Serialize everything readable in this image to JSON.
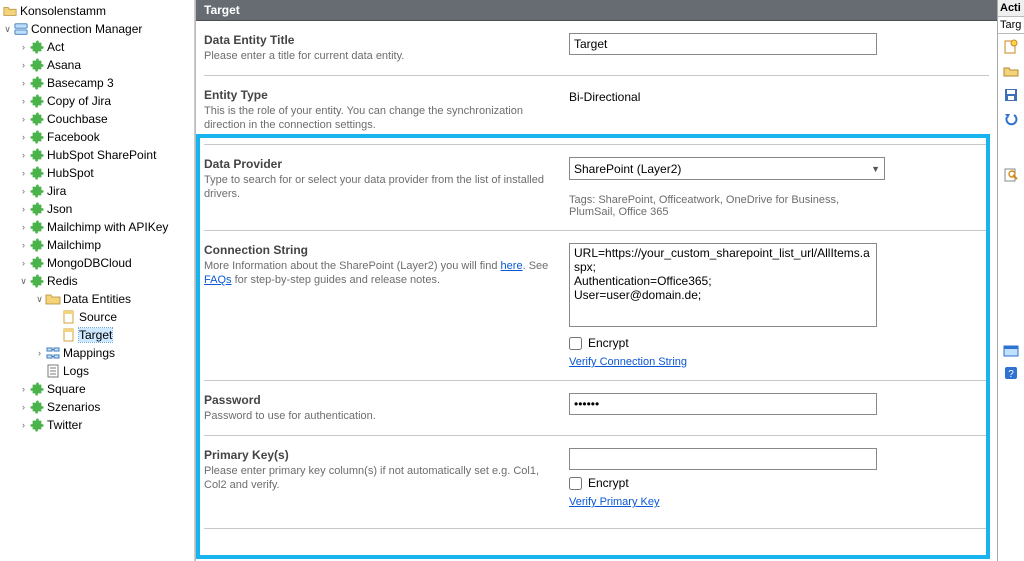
{
  "tree": {
    "root": "Konsolenstamm",
    "connMgr": "Connection Manager",
    "connections": [
      "Act",
      "Asana",
      "Basecamp 3",
      "Copy of Jira",
      "Couchbase",
      "Facebook",
      "HubSpot SharePoint",
      "HubSpot",
      "Jira",
      "Json",
      "Mailchimp with APIKey",
      "Mailchimp",
      "MongoDBCloud",
      "Redis",
      "Square",
      "Szenarios",
      "Twitter"
    ],
    "redis": {
      "dataEntities": "Data Entities",
      "items": [
        "Source",
        "Target"
      ],
      "mappings": "Mappings",
      "logs": "Logs"
    }
  },
  "panel": {
    "title": "Target",
    "entityTitle": {
      "hd": "Data Entity Title",
      "desc": "Please enter a title for current data entity.",
      "value": "Target"
    },
    "entityType": {
      "hd": "Entity Type",
      "desc": "This is the role of your entity. You can change the synchronization direction in the connection settings.",
      "value": "Bi-Directional"
    },
    "provider": {
      "hd": "Data Provider",
      "desc": "Type to search for or select your data provider from the list of installed drivers.",
      "value": "SharePoint (Layer2)",
      "tags": "Tags: SharePoint, Officeatwork, OneDrive for Business, PlumSail, Office 365"
    },
    "connStr": {
      "hd": "Connection String",
      "desc_pre": "More Information about the SharePoint (Layer2) you will find ",
      "here": "here",
      "desc_mid": ". See ",
      "faqs": "FAQs",
      "desc_post": " for step-by-step guides and release notes.",
      "value": "URL=https://your_custom_sharepoint_list_url/AllItems.aspx;\nAuthentication=Office365;\nUser=user@domain.de;",
      "encrypt": "Encrypt",
      "verify": "Verify Connection String"
    },
    "password": {
      "hd": "Password",
      "desc": "Password to use for authentication.",
      "value": "••••••"
    },
    "pk": {
      "hd": "Primary Key(s)",
      "desc": "Please enter primary key column(s) if not automatically set e.g. Col1, Col2 and verify.",
      "value": "",
      "encrypt": "Encrypt",
      "verify": "Verify Primary Key"
    }
  },
  "rstrip": {
    "actions": "Acti",
    "target": "Targ"
  }
}
